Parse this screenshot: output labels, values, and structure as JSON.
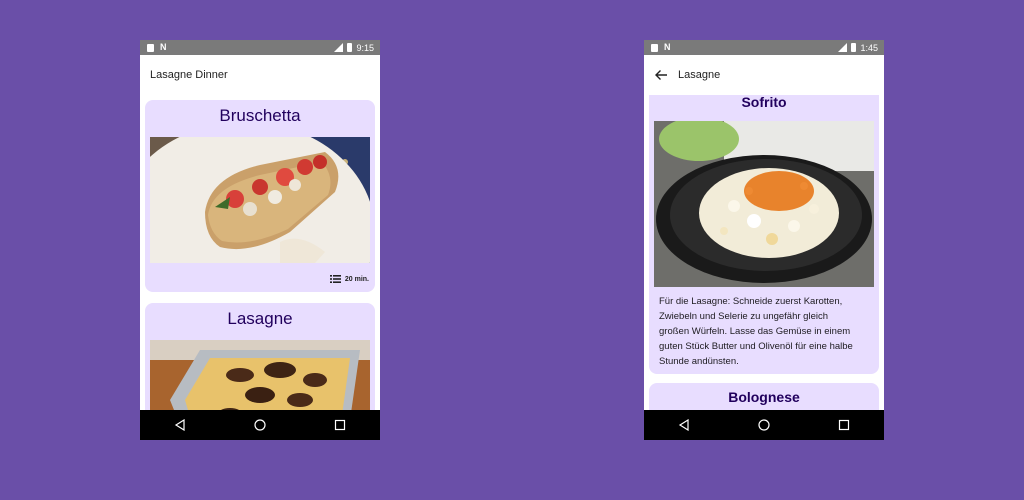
{
  "background_color": "#6a4fa8",
  "card_color": "#e8ddff",
  "title_color": "#21005d",
  "left_phone": {
    "status": {
      "time": "9:15",
      "icons": [
        "sd-card-icon",
        "n-icon",
        "signal-icon",
        "battery-icon"
      ]
    },
    "app_bar": {
      "title": "Lasagne Dinner"
    },
    "cards": [
      {
        "title": "Bruschetta",
        "image": "bruschetta-photo",
        "meta": {
          "icon": "list-icon",
          "time": "20 min."
        }
      },
      {
        "title": "Lasagne",
        "image": "lasagne-photo"
      }
    ],
    "nav": [
      "back-icon",
      "home-icon",
      "recents-icon"
    ]
  },
  "right_phone": {
    "status": {
      "time": "1:45",
      "icons": [
        "sd-card-icon",
        "n-icon",
        "signal-icon",
        "battery-icon"
      ]
    },
    "app_bar": {
      "title": "Lasagne",
      "back_icon": "arrow-left-icon"
    },
    "cards": [
      {
        "title": "Sofrito",
        "image": "sofrito-pan-photo",
        "text_lines": [
          "Für die Lasagne: Schneide zuerst Karotten,",
          "Zwiebeln und Selerie zu ungefähr gleich",
          "großen Würfeln. Lasse das Gemüse in einem",
          "guten Stück Butter und Olivenöl für eine halbe",
          "Stunde andünsten."
        ]
      },
      {
        "title": "Bolognese"
      }
    ],
    "nav": [
      "back-icon",
      "home-icon",
      "recents-icon"
    ]
  }
}
